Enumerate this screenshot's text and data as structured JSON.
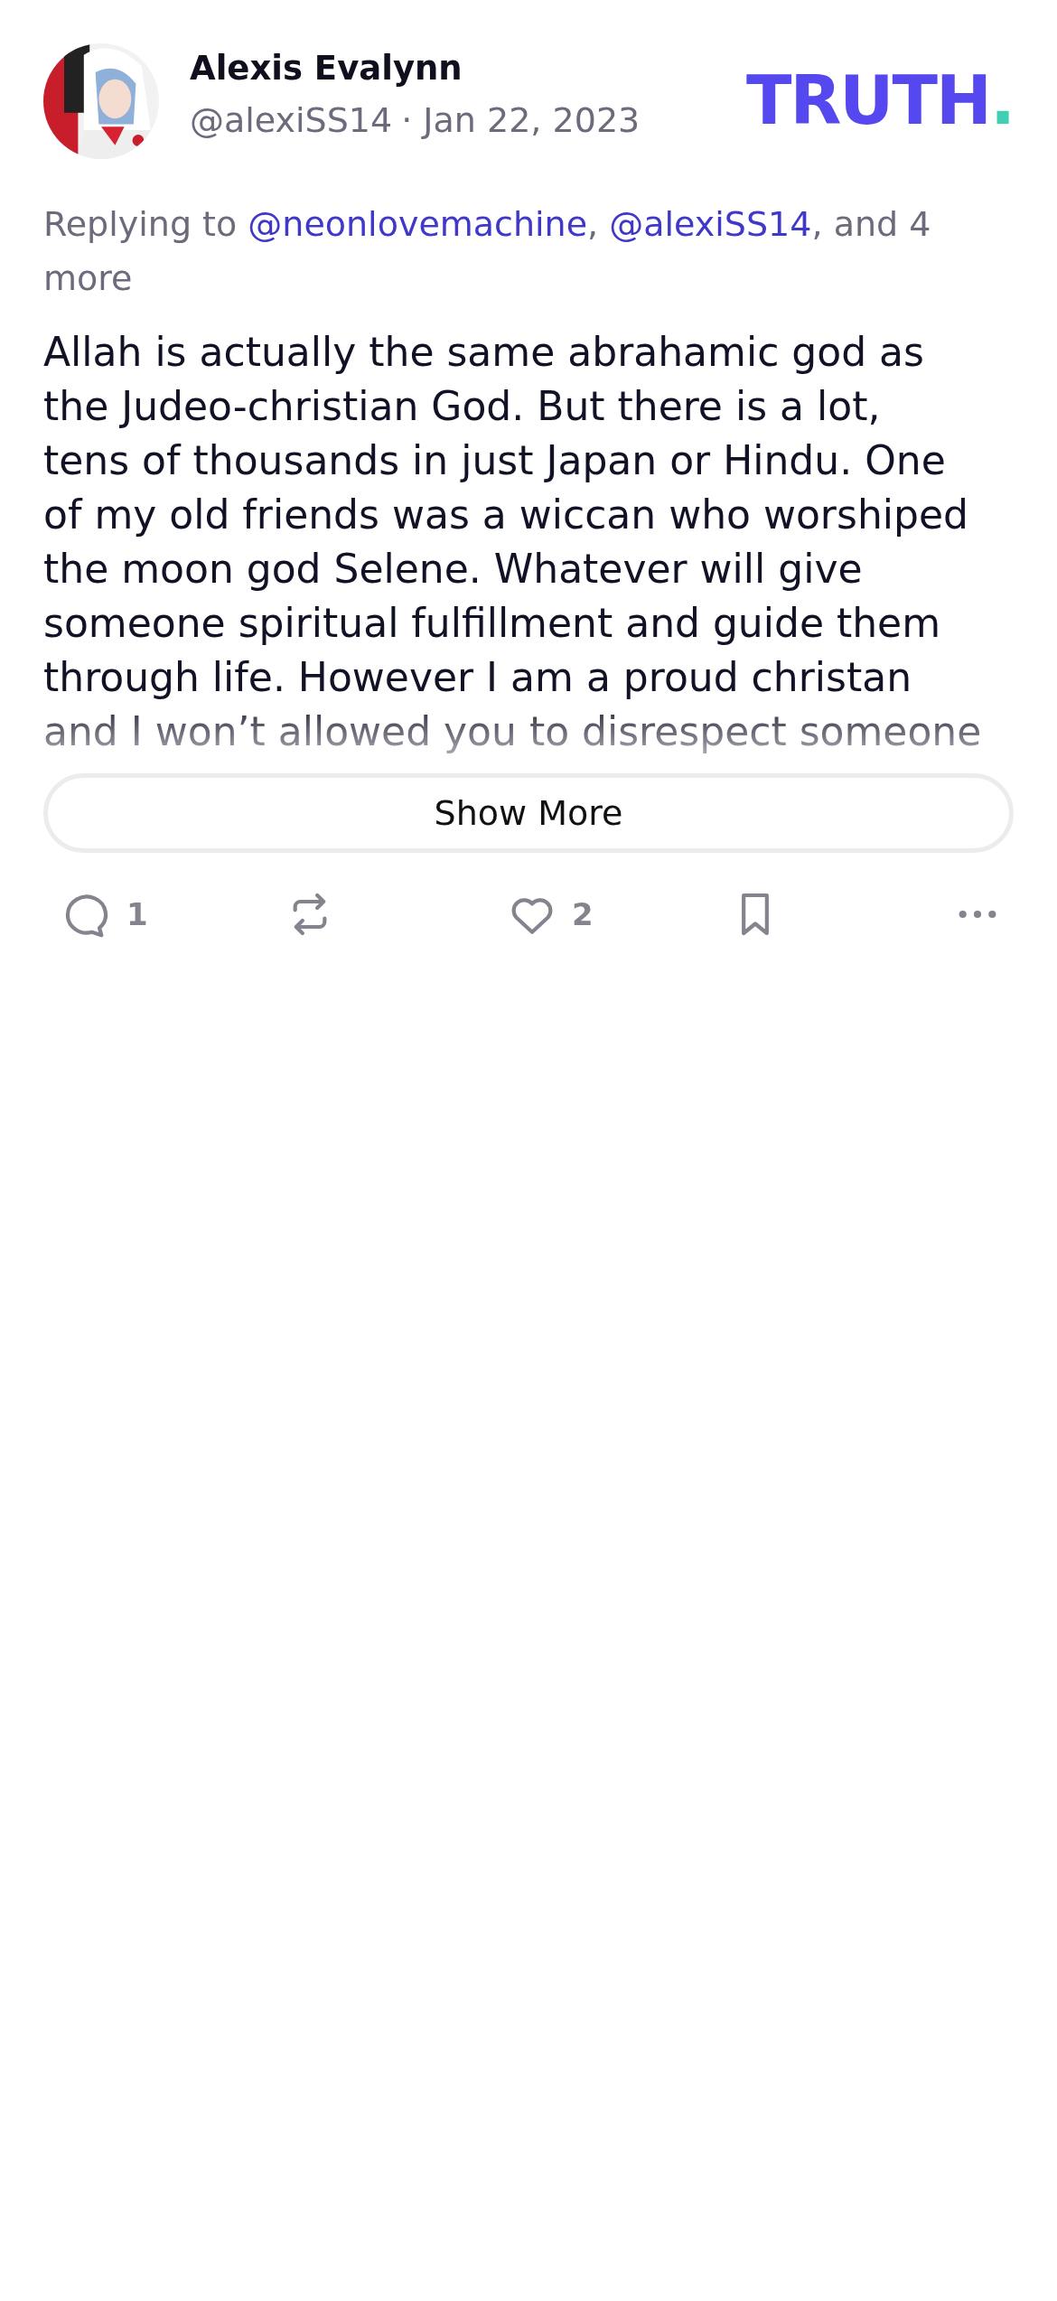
{
  "post": {
    "author": {
      "name": "Alexis Evalynn",
      "handle": "@alexiSS14",
      "separator": "·",
      "date": "Jan 22, 2023"
    },
    "logo": {
      "word": "TRUTH",
      "dot": "."
    },
    "reply_to": {
      "prefix": "Replying to ",
      "mentions": [
        "@neonlovemachine",
        "@alexiSS14"
      ],
      "mention_separator": ", ",
      "suffix": ", and 4 more"
    },
    "body_lines": [
      "Allah is actually the same abrahamic god as",
      "the Judeo-christian God. But there is a lot,",
      "tens of thousands in just Japan or Hindu. One",
      "of my old friends was a wiccan who worshiped",
      "the moon god Selene. Whatever will give",
      "someone spiritual fulfillment and guide them",
      "through life. However I am a proud christan",
      "and I won’t allowed you to disrespect someone"
    ],
    "show_more": "Show More",
    "actions": [
      {
        "kind": "reply",
        "count": "1"
      },
      {
        "kind": "repost"
      },
      {
        "kind": "like",
        "count": "2"
      },
      {
        "kind": "bookmark"
      },
      {
        "kind": "more"
      }
    ]
  }
}
